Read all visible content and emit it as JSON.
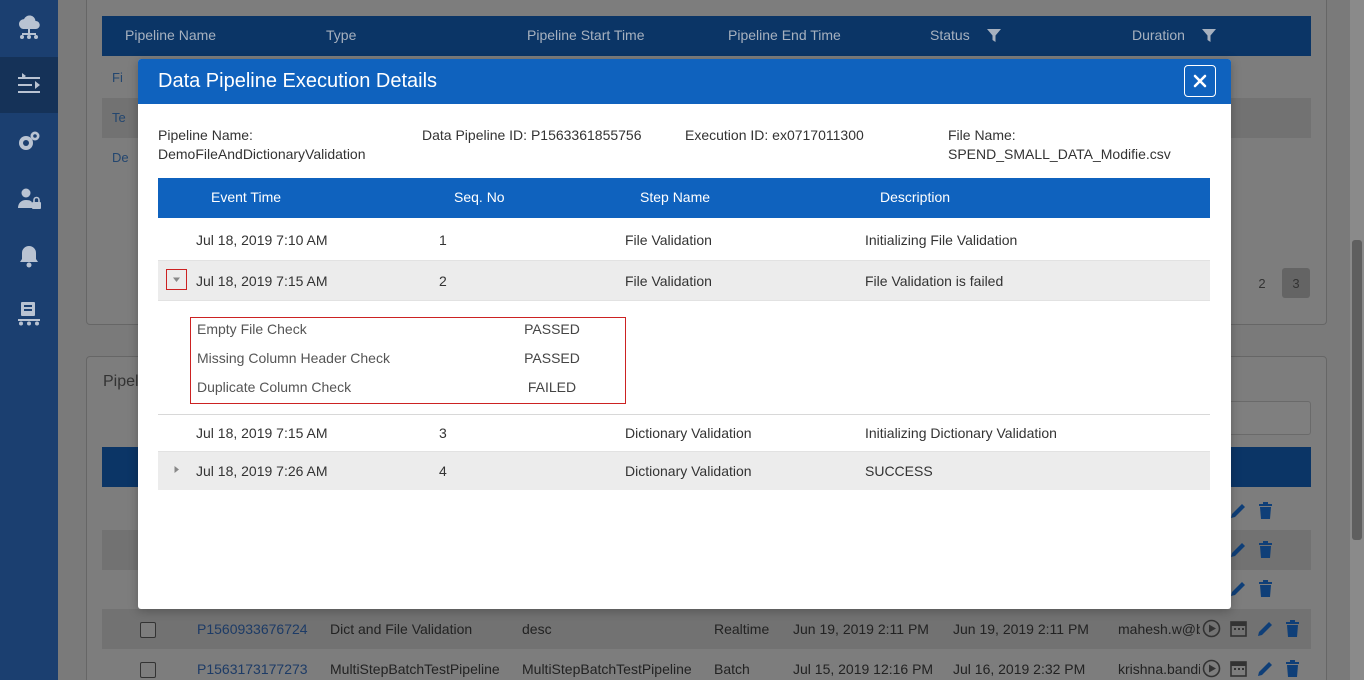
{
  "sidebar": {
    "items": [
      {
        "icon": "cloud-network-icon"
      },
      {
        "icon": "pipeline-shuffle-icon",
        "active": true
      },
      {
        "icon": "gears-icon"
      },
      {
        "icon": "user-lock-icon"
      },
      {
        "icon": "bell-icon"
      },
      {
        "icon": "server-conveyor-icon"
      }
    ]
  },
  "background": {
    "grid1": {
      "headers": [
        "Pipeline Name",
        "Type",
        "Pipeline Start Time",
        "Pipeline End Time",
        "Status",
        "Duration"
      ],
      "rows": [
        "Fi",
        "Te",
        "De"
      ]
    },
    "pager": {
      "page_2": "2",
      "page_3": "3"
    },
    "panel2": {
      "title": "Pipel",
      "rows": [
        {
          "id": "P1560933676724",
          "name": "Dict and File Validation",
          "desc": "desc",
          "mode": "Realtime",
          "start": "Jun 19, 2019 2:11 PM",
          "end": "Jun 19, 2019 2:11 PM",
          "user": "mahesh.w@b"
        },
        {
          "id": "P1563173177273",
          "name": "MultiStepBatchTestPipeline",
          "desc": "MultiStepBatchTestPipeline",
          "mode": "Batch",
          "start": "Jul 15, 2019 12:16 PM",
          "end": "Jul 16, 2019 2:32 PM",
          "user": "krishna.bandi"
        }
      ]
    }
  },
  "modal": {
    "title": "Data Pipeline Execution Details",
    "meta": {
      "pipeline_name_label": "Pipeline Name:",
      "pipeline_name": "DemoFileAndDictionaryValidation",
      "pipeline_id": "Data Pipeline ID: P1563361855756",
      "execution_id": "Execution ID: ex0717011300",
      "file_name_label": "File Name:",
      "file_name": "SPEND_SMALL_DATA_Modifie.csv"
    },
    "grid": {
      "headers": {
        "event_time": "Event Time",
        "seq_no": "Seq. No",
        "step_name": "Step Name",
        "description": "Description"
      },
      "rows": [
        {
          "time": "Jul 18, 2019 7:10 AM",
          "seq": "1",
          "step": "File Validation",
          "desc": "Initializing File Validation"
        },
        {
          "time": "Jul 18, 2019 7:15 AM",
          "seq": "2",
          "step": "File Validation",
          "desc": "File Validation is failed"
        },
        {
          "time": "Jul 18, 2019 7:15 AM",
          "seq": "3",
          "step": "Dictionary Validation",
          "desc": "Initializing Dictionary Validation"
        },
        {
          "time": "Jul 18, 2019 7:26 AM",
          "seq": "4",
          "step": "Dictionary Validation",
          "desc": "SUCCESS"
        }
      ],
      "checks": [
        {
          "name": "Empty File Check",
          "status": "PASSED"
        },
        {
          "name": "Missing Column Header Check",
          "status": "PASSED"
        },
        {
          "name": "Duplicate Column Check",
          "status": "FAILED"
        }
      ]
    }
  },
  "colors": {
    "primary": "#0f62be",
    "sidebar": "#1b3f70",
    "highlight": "#cc2222"
  }
}
